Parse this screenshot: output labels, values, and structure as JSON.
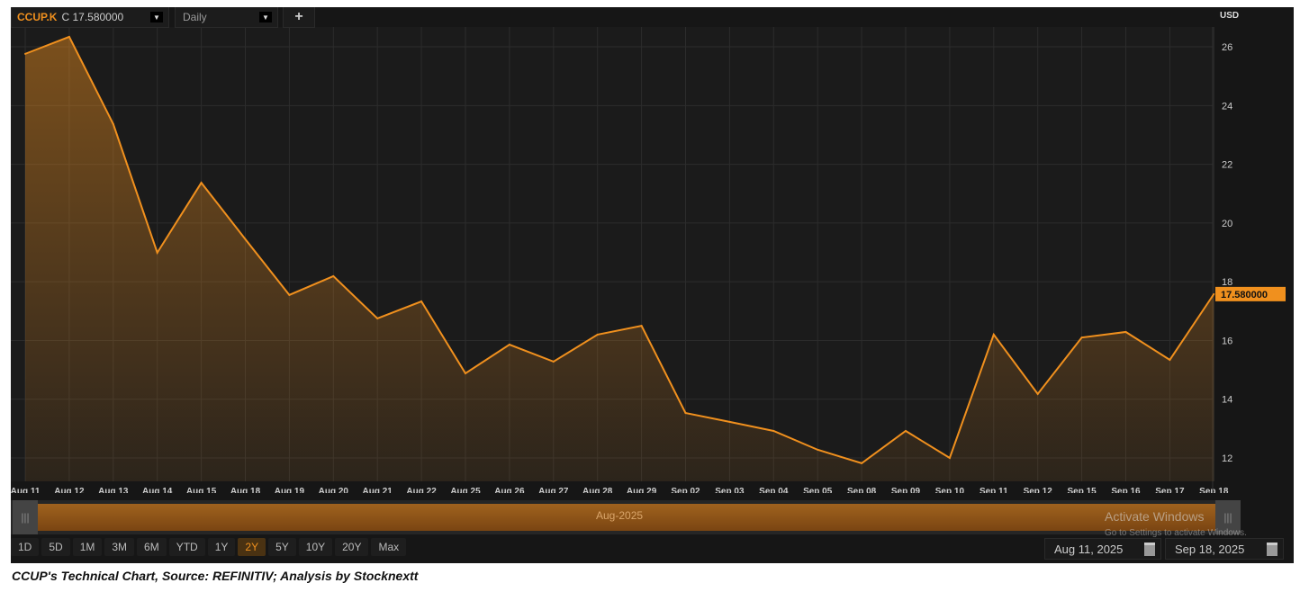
{
  "header": {
    "ric": "CCUP.K",
    "close": "C 17.580000",
    "interval": "Daily",
    "add": "+",
    "currency": "USD"
  },
  "chart_data": {
    "type": "area",
    "title": "CCUP.K Daily",
    "ylabel": "USD",
    "ylim": [
      11.2,
      27.3
    ],
    "yticks": [
      12,
      14,
      16,
      18,
      20,
      22,
      24,
      26
    ],
    "categories": [
      "Aug 11",
      "Aug 12",
      "Aug 13",
      "Aug 14",
      "Aug 15",
      "Aug 18",
      "Aug 19",
      "Aug 20",
      "Aug 21",
      "Aug 22",
      "Aug 25",
      "Aug 26",
      "Aug 27",
      "Aug 28",
      "Aug 29",
      "Sep 02",
      "Sep 03",
      "Sep 04",
      "Sep 05",
      "Sep 08",
      "Sep 09",
      "Sep 10",
      "Sep 11",
      "Sep 12",
      "Sep 15",
      "Sep 16",
      "Sep 17",
      "Sep 18"
    ],
    "values": [
      25.76,
      26.34,
      23.37,
      18.99,
      21.37,
      19.45,
      17.55,
      18.19,
      16.75,
      17.33,
      14.88,
      15.86,
      15.28,
      16.2,
      16.5,
      13.53,
      13.23,
      12.92,
      12.28,
      11.82,
      12.92,
      12.0,
      16.2,
      14.18,
      16.1,
      16.29,
      15.34,
      17.58
    ],
    "last_label": "17.580000",
    "grid": true,
    "color": "#f0901e"
  },
  "navigator": {
    "label": "Aug-2025"
  },
  "ranges": [
    "1D",
    "5D",
    "1M",
    "3M",
    "6M",
    "YTD",
    "1Y",
    "2Y",
    "5Y",
    "10Y",
    "20Y",
    "Max"
  ],
  "active_range": "2Y",
  "dates": {
    "from": "Aug 11, 2025",
    "to": "Sep 18, 2025"
  },
  "watermark": {
    "title": "Activate Windows",
    "sub": "Go to Settings to activate Windows."
  },
  "caption": "CCUP's Technical Chart, Source: REFINITIV; Analysis by Stocknextt"
}
